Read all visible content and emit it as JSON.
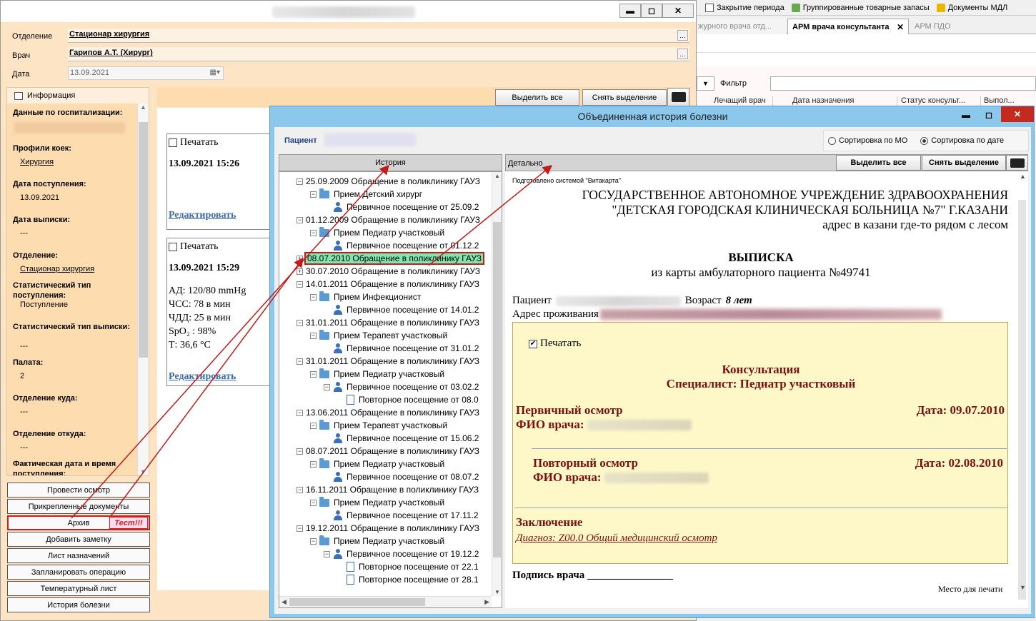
{
  "top_toolbar": {
    "items": [
      "Закрытие периода",
      "Группированные товарные запасы",
      "Документы МДЛ"
    ]
  },
  "back_tabs": [
    "журного врача отд...",
    "АРМ врача консультанта",
    "АРМ ПДО"
  ],
  "back_grid": {
    "filter_label": "Фильтр",
    "columns": [
      "Лечащий врач",
      "Дата назначения консультации",
      "Статус консульт...",
      "Выпол..."
    ]
  },
  "left_window": {
    "fields": {
      "department_label": "Отделение",
      "department_value": "Стационар  хирургия",
      "doctor_label": "Врач",
      "doctor_value": "Гарипов А.Т. (Хирург)",
      "date_label": "Дата",
      "date_value": "13.09.2021"
    },
    "info_title": "Информация",
    "info": [
      {
        "label": "Данные по госпитализации:",
        "value": ""
      },
      {
        "label": "Профили коек:",
        "value": "Хирургия"
      },
      {
        "label": "Дата поступления:",
        "value": "13.09.2021"
      },
      {
        "label": "Дата выписки:",
        "value": "---"
      },
      {
        "label": "Отделение:",
        "value": "Стационар  хирургия"
      },
      {
        "label": "Статистический тип поступления:",
        "value": "Поступление"
      },
      {
        "label": "Статистический тип выписки:",
        "value": "---"
      },
      {
        "label": "Палата:",
        "value": "2"
      },
      {
        "label": "Отделение куда:",
        "value": "---"
      },
      {
        "label": "Отделение откуда:",
        "value": "---"
      },
      {
        "label": "Фактическая дата и время поступления:",
        "value": ""
      }
    ],
    "select_all": "Выделить все",
    "deselect": "Снять выделение",
    "cards": [
      {
        "print": "Печатать",
        "date": "13.09.2021 15:26",
        "edit": "Редактировать"
      },
      {
        "print": "Печатать",
        "date": "13.09.2021 15:29",
        "vitals": [
          "АД: 120/80 mmHg",
          "ЧСС: 78 в мин",
          "ЧДД: 25 в мин",
          "SpO₂  : 98%",
          "Т: 36,6 °C"
        ],
        "edit": "Редактировать"
      }
    ],
    "buttons": [
      "Провести осмотр",
      "Прикрепленные документы",
      "Архив",
      "Добавить заметку",
      "Лист назначений",
      "Запланировать операцию",
      "Температурный лист",
      "История болезни"
    ],
    "test_badge": "Тест!!!"
  },
  "history_window": {
    "title": "Объединенная история болезни",
    "patient_label": "Пациент",
    "sort_mo": "Сортировка по МО",
    "sort_date": "Сортировка по дате",
    "history_header": "История",
    "detail_header": "Детально",
    "select_all": "Выделить все",
    "deselect": "Снять выделение",
    "tree": [
      {
        "level": 0,
        "icon": "none",
        "text": "25.09.2009  Обращение в поликлинику ГАУЗ",
        "exp": "-"
      },
      {
        "level": 1,
        "icon": "folder",
        "text": "Прием Детский хирург",
        "exp": "-"
      },
      {
        "level": 2,
        "icon": "person",
        "text": "Первичное посещение от 25.09.2",
        "exp": ""
      },
      {
        "level": 0,
        "icon": "none",
        "text": "01.12.2009  Обращение в поликлинику ГАУЗ",
        "exp": "-"
      },
      {
        "level": 1,
        "icon": "folder",
        "text": "Прием Педиатр участковый",
        "exp": "-"
      },
      {
        "level": 2,
        "icon": "person",
        "text": "Первичное посещение от 01.12.2",
        "exp": ""
      },
      {
        "level": 0,
        "icon": "none",
        "text": "08.07.2010  Обращение в поликлинику ГАУЗ",
        "exp": "+",
        "selected": true
      },
      {
        "level": 0,
        "icon": "none",
        "text": "30.07.2010  Обращение в поликлинику ГАУЗ",
        "exp": "+"
      },
      {
        "level": 0,
        "icon": "none",
        "text": "14.01.2011  Обращение в поликлинику ГАУЗ",
        "exp": "-"
      },
      {
        "level": 1,
        "icon": "folder",
        "text": "Прием Инфекционист",
        "exp": "-"
      },
      {
        "level": 2,
        "icon": "person",
        "text": "Первичное посещение от 14.01.2",
        "exp": ""
      },
      {
        "level": 0,
        "icon": "none",
        "text": "31.01.2011  Обращение в поликлинику ГАУЗ",
        "exp": "-"
      },
      {
        "level": 1,
        "icon": "folder",
        "text": "Прием Терапевт участковый",
        "exp": "-"
      },
      {
        "level": 2,
        "icon": "person",
        "text": "Первичное посещение от 31.01.2",
        "exp": ""
      },
      {
        "level": 0,
        "icon": "none",
        "text": "31.01.2011  Обращение в поликлинику ГАУЗ",
        "exp": "-"
      },
      {
        "level": 1,
        "icon": "folder",
        "text": "Прием Педиатр участковый",
        "exp": "-"
      },
      {
        "level": 2,
        "icon": "person",
        "text": "Первичное посещение от 03.02.2",
        "exp": "-"
      },
      {
        "level": 3,
        "icon": "doc",
        "text": "Повторное посещение от 08.0",
        "exp": ""
      },
      {
        "level": 0,
        "icon": "none",
        "text": "13.06.2011  Обращение в поликлинику ГАУЗ",
        "exp": "-"
      },
      {
        "level": 1,
        "icon": "folder",
        "text": "Прием Терапевт участковый",
        "exp": "-"
      },
      {
        "level": 2,
        "icon": "person",
        "text": "Первичное посещение от 15.06.2",
        "exp": ""
      },
      {
        "level": 0,
        "icon": "none",
        "text": "08.07.2011  Обращение в поликлинику ГАУЗ",
        "exp": "-"
      },
      {
        "level": 1,
        "icon": "folder",
        "text": "Прием Педиатр участковый",
        "exp": "-"
      },
      {
        "level": 2,
        "icon": "person",
        "text": "Первичное посещение от 08.07.2",
        "exp": ""
      },
      {
        "level": 0,
        "icon": "none",
        "text": "16.11.2011  Обращение в поликлинику ГАУЗ",
        "exp": "-"
      },
      {
        "level": 1,
        "icon": "folder",
        "text": "Прием Педиатр участковый",
        "exp": "-"
      },
      {
        "level": 2,
        "icon": "person",
        "text": "Первичное посещение от 17.11.2",
        "exp": ""
      },
      {
        "level": 0,
        "icon": "none",
        "text": "19.12.2011  Обращение в поликлинику ГАУЗ",
        "exp": "-"
      },
      {
        "level": 1,
        "icon": "folder",
        "text": "Прием Педиатр участковый",
        "exp": "-"
      },
      {
        "level": 2,
        "icon": "person",
        "text": "Первичное посещение от 19.12.2",
        "exp": "-"
      },
      {
        "level": 3,
        "icon": "doc",
        "text": "Повторное посещение от 22.1",
        "exp": ""
      },
      {
        "level": 3,
        "icon": "doc",
        "text": "Повторное посещение от 28.1",
        "exp": ""
      }
    ],
    "doc": {
      "prepared": "Подготовлено системой \"Витакарта\"",
      "org1": "ГОСУДАРСТВЕННОЕ АВТОНОМНОЕ УЧРЕЖДЕНИЕ ЗДРАВООХРАНЕНИЯ",
      "org2": "\"ДЕТСКАЯ ГОРОДСКАЯ КЛИНИЧЕСКАЯ БОЛЬНИЦА №7\" Г.КАЗАНИ",
      "address": "адрес в казани где-то рядом с лесом",
      "title": "ВЫПИСКА",
      "subtitle": "из карты амбулаторного пациента №49741",
      "patient_label": "Пациент",
      "age_label": "Возраст",
      "age_value": "8 лет",
      "residence_label": "Адрес проживания",
      "print": "Печатать",
      "consult_title": "Консультация",
      "specialist": "Специалист: Педиатр участковый",
      "primary": "Первичный осмотр",
      "primary_date": "Дата: 09.07.2010",
      "doctor_fio": "ФИО врача:",
      "repeat": "Повторный осмотр",
      "repeat_date": "Дата: 02.08.2010",
      "conclusion": "Заключение",
      "diagnosis": "Диагноз: Z00.0 Общий медицинский осмотр",
      "signature": "Подпись врача ________________",
      "stamp": "Место для печати"
    }
  }
}
